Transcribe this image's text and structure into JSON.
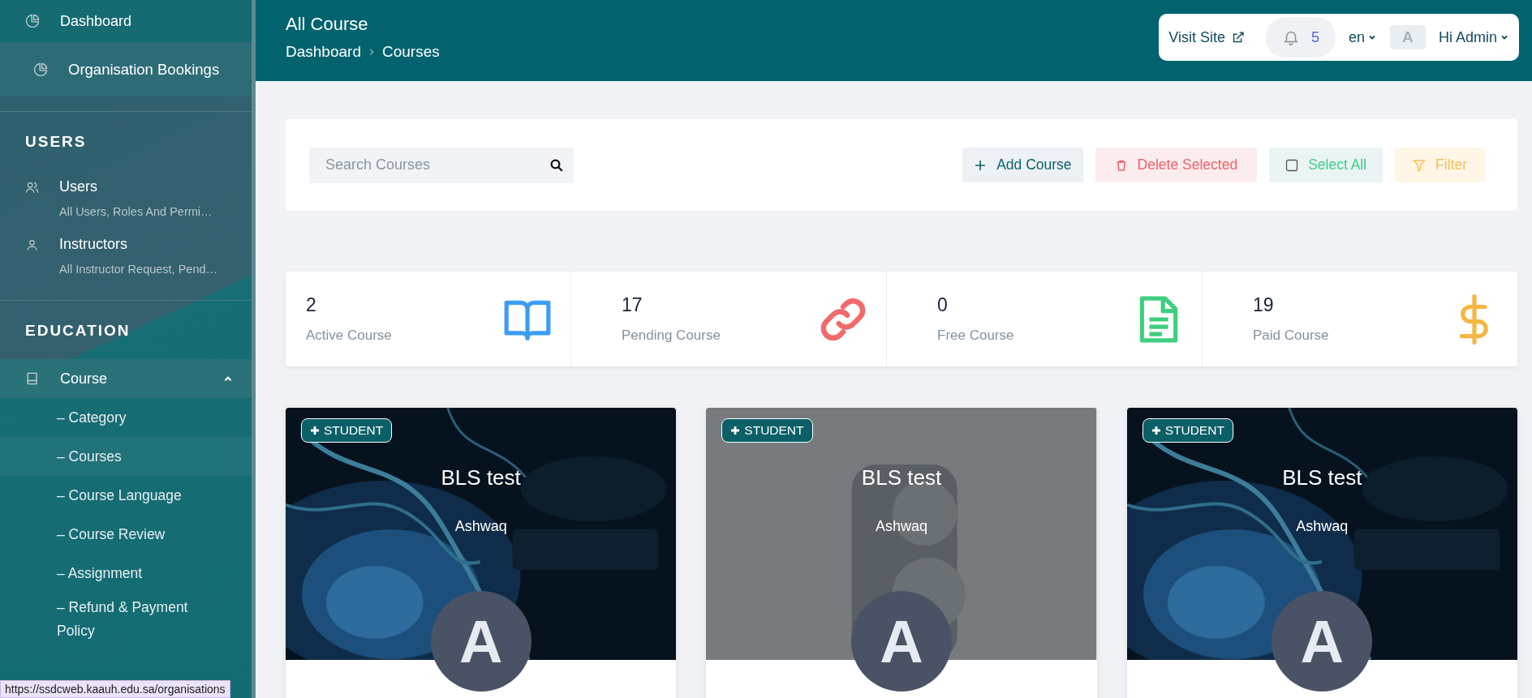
{
  "sidebar": {
    "top_items": [
      {
        "label": "Dashboard",
        "hovered": false
      },
      {
        "label": "Organisation Bookings",
        "hovered": true
      }
    ],
    "sections": [
      {
        "heading": "USERS",
        "items": [
          {
            "kind": "users",
            "label": "Users",
            "subtitle": "All Users, Roles And Permi…"
          },
          {
            "kind": "user",
            "label": "Instructors",
            "subtitle": "All Instructor Request, Pend…"
          }
        ]
      },
      {
        "heading": "EDUCATION",
        "items": [
          {
            "kind": "book",
            "label": "Course",
            "expanded": true,
            "children": [
              {
                "label": "– Category",
                "selected": false
              },
              {
                "label": "– Courses",
                "selected": true
              },
              {
                "label": "– Course Language",
                "selected": false
              },
              {
                "label": "– Course Review",
                "selected": false
              },
              {
                "label": "– Assignment",
                "selected": false
              },
              {
                "label": "– Refund & Payment Policy",
                "selected": false
              }
            ]
          }
        ]
      }
    ]
  },
  "header": {
    "title": "All Course",
    "breadcrumb": [
      "Dashboard",
      "Courses"
    ],
    "visit_site": "Visit Site",
    "notifications": "5",
    "language": "en",
    "avatar": "A",
    "user": "Hi Admin"
  },
  "toolbar": {
    "search": {
      "placeholder": "Search Courses"
    },
    "buttons": [
      {
        "kind": "add",
        "label": "Add Course"
      },
      {
        "kind": "delete",
        "label": "Delete Selected"
      },
      {
        "kind": "select",
        "label": "Select All"
      },
      {
        "kind": "filter",
        "label": "Filter"
      }
    ]
  },
  "stats": [
    {
      "kind": "book",
      "value": "2",
      "label": "Active Course",
      "color": "#3b9cf5"
    },
    {
      "kind": "link",
      "value": "17",
      "label": "Pending Course",
      "color": "#f26a6a"
    },
    {
      "kind": "document",
      "value": "0",
      "label": "Free Course",
      "color": "#3ecf7e"
    },
    {
      "kind": "dollar",
      "value": "19",
      "label": "Paid Course",
      "color": "#f5b642"
    }
  ],
  "courses": [
    {
      "kind": "picture",
      "badge": "STUDENT",
      "title": "BLS test",
      "instructor": "Ashwaq",
      "avatar": "A"
    },
    {
      "kind": "placeholder",
      "badge": "STUDENT",
      "title": "BLS test",
      "instructor": "Ashwaq",
      "avatar": "A"
    },
    {
      "kind": "picture",
      "badge": "STUDENT",
      "title": "BLS test",
      "instructor": "Ashwaq",
      "avatar": "A"
    }
  ],
  "status_bar": "https://ssdcweb.kaauh.edu.sa/organisations"
}
